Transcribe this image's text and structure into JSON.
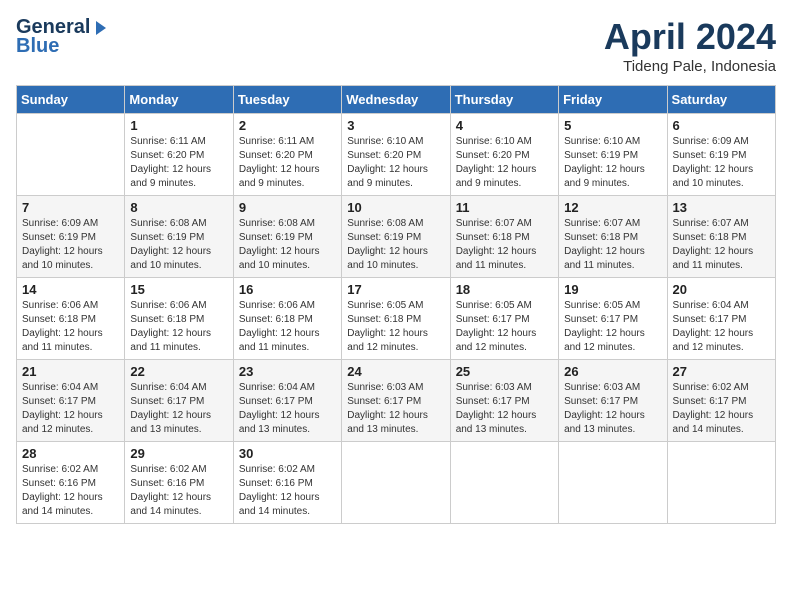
{
  "header": {
    "logo_line1": "General",
    "logo_line2": "Blue",
    "month_year": "April 2024",
    "location": "Tideng Pale, Indonesia"
  },
  "days_of_week": [
    "Sunday",
    "Monday",
    "Tuesday",
    "Wednesday",
    "Thursday",
    "Friday",
    "Saturday"
  ],
  "weeks": [
    [
      {
        "day": "",
        "sunrise": "",
        "sunset": "",
        "daylight": ""
      },
      {
        "day": "1",
        "sunrise": "Sunrise: 6:11 AM",
        "sunset": "Sunset: 6:20 PM",
        "daylight": "Daylight: 12 hours and 9 minutes."
      },
      {
        "day": "2",
        "sunrise": "Sunrise: 6:11 AM",
        "sunset": "Sunset: 6:20 PM",
        "daylight": "Daylight: 12 hours and 9 minutes."
      },
      {
        "day": "3",
        "sunrise": "Sunrise: 6:10 AM",
        "sunset": "Sunset: 6:20 PM",
        "daylight": "Daylight: 12 hours and 9 minutes."
      },
      {
        "day": "4",
        "sunrise": "Sunrise: 6:10 AM",
        "sunset": "Sunset: 6:20 PM",
        "daylight": "Daylight: 12 hours and 9 minutes."
      },
      {
        "day": "5",
        "sunrise": "Sunrise: 6:10 AM",
        "sunset": "Sunset: 6:19 PM",
        "daylight": "Daylight: 12 hours and 9 minutes."
      },
      {
        "day": "6",
        "sunrise": "Sunrise: 6:09 AM",
        "sunset": "Sunset: 6:19 PM",
        "daylight": "Daylight: 12 hours and 10 minutes."
      }
    ],
    [
      {
        "day": "7",
        "sunrise": "Sunrise: 6:09 AM",
        "sunset": "Sunset: 6:19 PM",
        "daylight": "Daylight: 12 hours and 10 minutes."
      },
      {
        "day": "8",
        "sunrise": "Sunrise: 6:08 AM",
        "sunset": "Sunset: 6:19 PM",
        "daylight": "Daylight: 12 hours and 10 minutes."
      },
      {
        "day": "9",
        "sunrise": "Sunrise: 6:08 AM",
        "sunset": "Sunset: 6:19 PM",
        "daylight": "Daylight: 12 hours and 10 minutes."
      },
      {
        "day": "10",
        "sunrise": "Sunrise: 6:08 AM",
        "sunset": "Sunset: 6:19 PM",
        "daylight": "Daylight: 12 hours and 10 minutes."
      },
      {
        "day": "11",
        "sunrise": "Sunrise: 6:07 AM",
        "sunset": "Sunset: 6:18 PM",
        "daylight": "Daylight: 12 hours and 11 minutes."
      },
      {
        "day": "12",
        "sunrise": "Sunrise: 6:07 AM",
        "sunset": "Sunset: 6:18 PM",
        "daylight": "Daylight: 12 hours and 11 minutes."
      },
      {
        "day": "13",
        "sunrise": "Sunrise: 6:07 AM",
        "sunset": "Sunset: 6:18 PM",
        "daylight": "Daylight: 12 hours and 11 minutes."
      }
    ],
    [
      {
        "day": "14",
        "sunrise": "Sunrise: 6:06 AM",
        "sunset": "Sunset: 6:18 PM",
        "daylight": "Daylight: 12 hours and 11 minutes."
      },
      {
        "day": "15",
        "sunrise": "Sunrise: 6:06 AM",
        "sunset": "Sunset: 6:18 PM",
        "daylight": "Daylight: 12 hours and 11 minutes."
      },
      {
        "day": "16",
        "sunrise": "Sunrise: 6:06 AM",
        "sunset": "Sunset: 6:18 PM",
        "daylight": "Daylight: 12 hours and 11 minutes."
      },
      {
        "day": "17",
        "sunrise": "Sunrise: 6:05 AM",
        "sunset": "Sunset: 6:18 PM",
        "daylight": "Daylight: 12 hours and 12 minutes."
      },
      {
        "day": "18",
        "sunrise": "Sunrise: 6:05 AM",
        "sunset": "Sunset: 6:17 PM",
        "daylight": "Daylight: 12 hours and 12 minutes."
      },
      {
        "day": "19",
        "sunrise": "Sunrise: 6:05 AM",
        "sunset": "Sunset: 6:17 PM",
        "daylight": "Daylight: 12 hours and 12 minutes."
      },
      {
        "day": "20",
        "sunrise": "Sunrise: 6:04 AM",
        "sunset": "Sunset: 6:17 PM",
        "daylight": "Daylight: 12 hours and 12 minutes."
      }
    ],
    [
      {
        "day": "21",
        "sunrise": "Sunrise: 6:04 AM",
        "sunset": "Sunset: 6:17 PM",
        "daylight": "Daylight: 12 hours and 12 minutes."
      },
      {
        "day": "22",
        "sunrise": "Sunrise: 6:04 AM",
        "sunset": "Sunset: 6:17 PM",
        "daylight": "Daylight: 12 hours and 13 minutes."
      },
      {
        "day": "23",
        "sunrise": "Sunrise: 6:04 AM",
        "sunset": "Sunset: 6:17 PM",
        "daylight": "Daylight: 12 hours and 13 minutes."
      },
      {
        "day": "24",
        "sunrise": "Sunrise: 6:03 AM",
        "sunset": "Sunset: 6:17 PM",
        "daylight": "Daylight: 12 hours and 13 minutes."
      },
      {
        "day": "25",
        "sunrise": "Sunrise: 6:03 AM",
        "sunset": "Sunset: 6:17 PM",
        "daylight": "Daylight: 12 hours and 13 minutes."
      },
      {
        "day": "26",
        "sunrise": "Sunrise: 6:03 AM",
        "sunset": "Sunset: 6:17 PM",
        "daylight": "Daylight: 12 hours and 13 minutes."
      },
      {
        "day": "27",
        "sunrise": "Sunrise: 6:02 AM",
        "sunset": "Sunset: 6:17 PM",
        "daylight": "Daylight: 12 hours and 14 minutes."
      }
    ],
    [
      {
        "day": "28",
        "sunrise": "Sunrise: 6:02 AM",
        "sunset": "Sunset: 6:16 PM",
        "daylight": "Daylight: 12 hours and 14 minutes."
      },
      {
        "day": "29",
        "sunrise": "Sunrise: 6:02 AM",
        "sunset": "Sunset: 6:16 PM",
        "daylight": "Daylight: 12 hours and 14 minutes."
      },
      {
        "day": "30",
        "sunrise": "Sunrise: 6:02 AM",
        "sunset": "Sunset: 6:16 PM",
        "daylight": "Daylight: 12 hours and 14 minutes."
      },
      {
        "day": "",
        "sunrise": "",
        "sunset": "",
        "daylight": ""
      },
      {
        "day": "",
        "sunrise": "",
        "sunset": "",
        "daylight": ""
      },
      {
        "day": "",
        "sunrise": "",
        "sunset": "",
        "daylight": ""
      },
      {
        "day": "",
        "sunrise": "",
        "sunset": "",
        "daylight": ""
      }
    ]
  ]
}
